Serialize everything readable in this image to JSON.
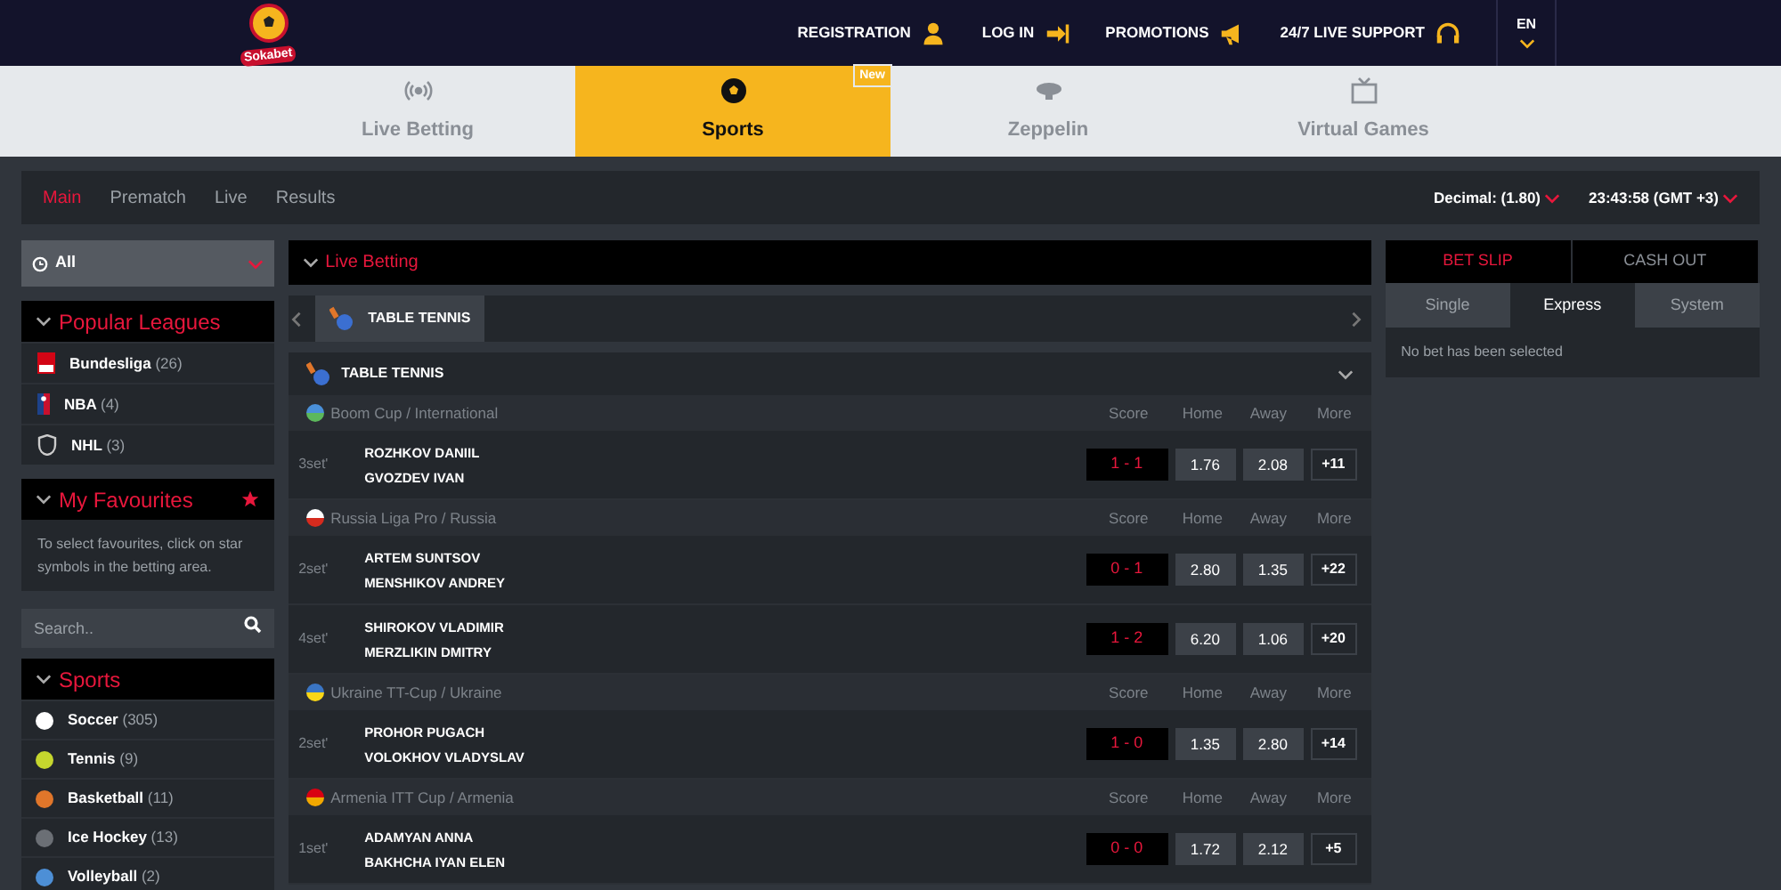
{
  "header": {
    "logo": "Sokabet",
    "links": [
      {
        "label": "REGISTRATION"
      },
      {
        "label": "LOG IN"
      },
      {
        "label": "PROMOTIONS"
      },
      {
        "label": "24/7 LIVE SUPPORT"
      }
    ],
    "language": "EN"
  },
  "nav_tabs": [
    {
      "label": "Live Betting",
      "selected": false
    },
    {
      "label": "Sports",
      "selected": true,
      "badge": "New"
    },
    {
      "label": "Zeppelin",
      "selected": false
    },
    {
      "label": "Virtual Games",
      "selected": false
    }
  ],
  "subnav": {
    "items": [
      {
        "label": "Main",
        "selected": true
      },
      {
        "label": "Prematch",
        "selected": false
      },
      {
        "label": "Live",
        "selected": false
      },
      {
        "label": "Results",
        "selected": false
      }
    ],
    "odds_format": "Decimal: (1.80)",
    "clock": "23:43:58 (GMT +3)"
  },
  "sidebar": {
    "filter": "All",
    "popular_leagues": {
      "title": "Popular Leagues",
      "items": [
        {
          "name": "Bundesliga",
          "count": "(26)"
        },
        {
          "name": "NBA",
          "count": "(4)"
        },
        {
          "name": "NHL",
          "count": "(3)"
        }
      ]
    },
    "favourites": {
      "title": "My Favourites",
      "text": "To select favourites, click on star symbols in the betting area."
    },
    "search": {
      "placeholder": "Search.."
    },
    "sports": {
      "title": "Sports",
      "items": [
        {
          "name": "Soccer",
          "count": "(305)",
          "color": "#ffffff"
        },
        {
          "name": "Tennis",
          "count": "(9)",
          "color": "#c5d62e"
        },
        {
          "name": "Basketball",
          "count": "(11)",
          "color": "#e0762a"
        },
        {
          "name": "Ice Hockey",
          "count": "(13)",
          "color": "#6b6f75"
        },
        {
          "name": "Volleyball",
          "count": "(2)",
          "color": "#4d8fd6"
        }
      ]
    }
  },
  "main": {
    "title": "Live Betting",
    "sport_tabs": [
      {
        "label": "TABLE TENNIS",
        "selected": true
      }
    ],
    "sport_title": "TABLE TENNIS",
    "leagues": [
      {
        "name": "Boom Cup / International",
        "columns": [
          "Score",
          "Home",
          "Away",
          "More"
        ],
        "matches": [
          {
            "set": "3set'",
            "players": [
              "ROZHKOV DANIIL",
              "GVOZDEV IVAN"
            ],
            "score": "1 - 1",
            "home": "1.76",
            "away": "2.08",
            "more": "+11"
          }
        ]
      },
      {
        "name": "Russia Liga Pro / Russia",
        "columns": [
          "Score",
          "Home",
          "Away",
          "More"
        ],
        "matches": [
          {
            "set": "2set'",
            "players": [
              "ARTEM SUNTSOV",
              "MENSHIKOV ANDREY"
            ],
            "score": "0 - 1",
            "home": "2.80",
            "away": "1.35",
            "more": "+22"
          },
          {
            "set": "4set'",
            "players": [
              "SHIROKOV VLADIMIR",
              "MERZLIKIN DMITRY"
            ],
            "score": "1 - 2",
            "home": "6.20",
            "away": "1.06",
            "more": "+20"
          }
        ]
      },
      {
        "name": "Ukraine TT-Cup / Ukraine",
        "columns": [
          "Score",
          "Home",
          "Away",
          "More"
        ],
        "matches": [
          {
            "set": "2set'",
            "players": [
              "PROHOR PUGACH",
              "VOLOKHOV VLADYSLAV"
            ],
            "score": "1 - 0",
            "home": "1.35",
            "away": "2.80",
            "more": "+14"
          }
        ]
      },
      {
        "name": "Armenia ITT Cup / Armenia",
        "columns": [
          "Score",
          "Home",
          "Away",
          "More"
        ],
        "matches": [
          {
            "set": "1set'",
            "players": [
              "ADAMYAN ANNA",
              "BAKHCHA IYAN ELEN"
            ],
            "score": "0 - 0",
            "home": "1.72",
            "away": "2.12",
            "more": "+5"
          }
        ]
      }
    ]
  },
  "bet_slip": {
    "tabs": [
      {
        "label": "BET SLIP",
        "selected": true
      },
      {
        "label": "CASH OUT",
        "selected": false
      }
    ],
    "types": [
      {
        "label": "Single",
        "selected": false
      },
      {
        "label": "Express",
        "selected": true
      },
      {
        "label": "System",
        "selected": false
      }
    ],
    "empty_text": "No bet has been selected"
  }
}
